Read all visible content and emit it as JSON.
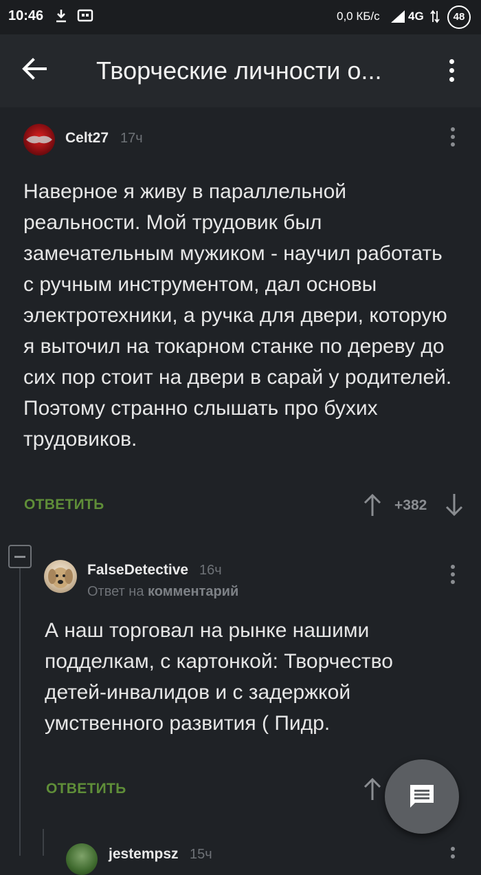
{
  "status": {
    "time": "10:46",
    "speed": "0,0 КБ/с",
    "network": "4G",
    "badge": "48"
  },
  "appbar": {
    "title": "Творческие личности о..."
  },
  "comments": [
    {
      "author": "Celt27",
      "time": "17ч",
      "paragraphs": [
        "Наверное я живу в параллельной реальности. Мой трудовик был замечательным мужиком - научил работать с ручным инструментом, дал основы электротехники, а ручка для двери, которую я выточил на токарном станке по дереву до сих пор стоит на двери в сарай у родителей.",
        "Поэтому странно слышать про бухих трудовиков."
      ],
      "reply_label": "ОТВЕТИТЬ",
      "rating": "+382"
    },
    {
      "author": "FalseDetective",
      "time": "16ч",
      "reply_to_prefix": "Ответ на",
      "reply_to_target": "комментарий",
      "paragraphs": [
        "А наш торговал на рынке нашими подделкам, с картонкой: Творчество детей-инвалидов и с задержкой умственного развития ( Пидр."
      ],
      "reply_label": "ОТВЕТИТЬ"
    },
    {
      "author": "jestempsz",
      "time": "15ч"
    }
  ],
  "icons": {
    "back": "arrow-left-icon",
    "menu": "more-vert-icon",
    "upvote": "arrow-up-icon",
    "downvote": "arrow-down-icon",
    "fab": "comment-icon"
  },
  "colors": {
    "background": "#1f2226",
    "appbar": "#25282c",
    "accent_green": "#5f8e38"
  }
}
